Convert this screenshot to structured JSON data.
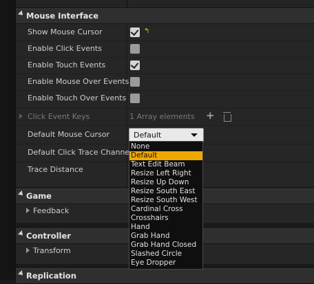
{
  "sections": {
    "mouse_interface": "Mouse Interface",
    "game": "Game",
    "controller": "Controller",
    "replication": "Replication"
  },
  "properties": {
    "show_mouse_cursor": {
      "label": "Show Mouse Cursor",
      "checked": true
    },
    "enable_click_events": {
      "label": "Enable Click Events",
      "checked": false
    },
    "enable_touch_events": {
      "label": "Enable Touch Events",
      "checked": true
    },
    "enable_mouse_over_events": {
      "label": "Enable Mouse Over Events",
      "checked": false
    },
    "enable_touch_over_events": {
      "label": "Enable Touch Over Events",
      "checked": false
    },
    "click_event_keys": {
      "label": "Click Event Keys",
      "value": "1 Array elements"
    },
    "default_mouse_cursor": {
      "label": "Default Mouse Cursor",
      "value": "Default"
    },
    "default_click_trace_channel": {
      "label": "Default Click Trace Channel"
    },
    "trace_distance": {
      "label": "Trace Distance"
    }
  },
  "subsections": {
    "feedback": "Feedback",
    "transform": "Transform"
  },
  "icons": {
    "reset": "reset-to-default-icon",
    "add": "plus-icon",
    "delete": "trash-icon"
  },
  "dropdown": {
    "options": [
      "None",
      "Default",
      "Text Edit Beam",
      "Resize Left Right",
      "Resize Up Down",
      "Resize South East",
      "Resize South West",
      "Cardinal Cross",
      "Crosshairs",
      "Hand",
      "Grab Hand",
      "Grab Hand Closed",
      "Slashed Circle",
      "Eye Dropper"
    ],
    "selected_index": 1
  },
  "colors": {
    "highlight": "#f0a800",
    "reset": "#e8c400"
  }
}
